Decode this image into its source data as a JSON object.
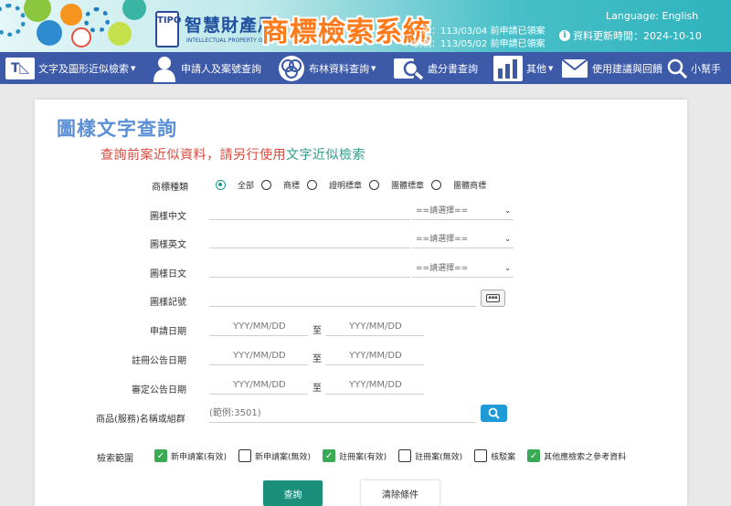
{
  "header": {
    "agency_name": "智慧財產局",
    "agency_name_en": "INTELLECTUAL PROPERTY OFFICE",
    "logo_text": "TIPO",
    "system_title": "商標檢索系統",
    "notice_general": "一般：113/03/04 前申請已領案",
    "notice_express": "快軌：113/05/02 前申請已領案",
    "language_label": "Language:",
    "language_link": "English",
    "update_label": "資料更新時間：2024-10-10",
    "colors": {
      "title": "#ff7a1a",
      "banner": "#2fb3bd"
    }
  },
  "nav": {
    "items": [
      {
        "label": "文字及圖形近似檢索",
        "icon": "text-image-icon",
        "dropdown": true
      },
      {
        "label": "申請人及案號查詢",
        "icon": "person-icon",
        "dropdown": false
      },
      {
        "label": "布林資料查詢",
        "icon": "venn-icon",
        "dropdown": true
      },
      {
        "label": "處分書查詢",
        "icon": "document-search-icon",
        "dropdown": false
      },
      {
        "label": "其他",
        "icon": "bar-chart-icon",
        "dropdown": true
      },
      {
        "label": "使用建議與回饋",
        "icon": "mail-icon",
        "dropdown": false
      },
      {
        "label": "小幫手",
        "icon": "search-icon",
        "dropdown": false
      }
    ],
    "color": "#3d5aa8"
  },
  "main": {
    "title": "圖樣文字查詢",
    "subtitle_prefix": "查詢前案近似資料，請另行使用",
    "subtitle_link": "文字近似檢索",
    "form": {
      "type_label": "商標種類",
      "type_options": [
        "全部",
        "商標",
        "證明標章",
        "團體標章",
        "團體商標"
      ],
      "type_selected": "全部",
      "chinese_label": "圖樣中文",
      "english_label": "圖樣英文",
      "japanese_label": "圖樣日文",
      "select_placeholder": "==請選擇==",
      "symbol_label": "圖樣記號",
      "apply_date_label": "申請日期",
      "reg_pub_date_label": "註冊公告日期",
      "exam_pub_date_label": "審定公告日期",
      "date_placeholder": "YYY/MM/DD",
      "date_separator": "至",
      "goods_label": "商品(服務)名稱或組群",
      "goods_placeholder": "(範例:3501)",
      "scope_label": "檢索範圍",
      "scope_options": [
        {
          "label": "新申請案(有效)",
          "checked": true
        },
        {
          "label": "新申請案(無效)",
          "checked": false
        },
        {
          "label": "註冊案(有效)",
          "checked": true
        },
        {
          "label": "註冊案(無效)",
          "checked": false
        },
        {
          "label": "核駁案",
          "checked": false
        },
        {
          "label": "其他應檢索之參考資料",
          "checked": true
        }
      ]
    },
    "query_button": "查詢",
    "clear_button": "清除條件",
    "colors": {
      "title": "#5b8fd6",
      "subtitle_prefix": "#d94a3d",
      "subtitle_link": "#2e9a8a",
      "query_button": "#1c8f7c",
      "checkbox": "#3aaa55"
    }
  }
}
